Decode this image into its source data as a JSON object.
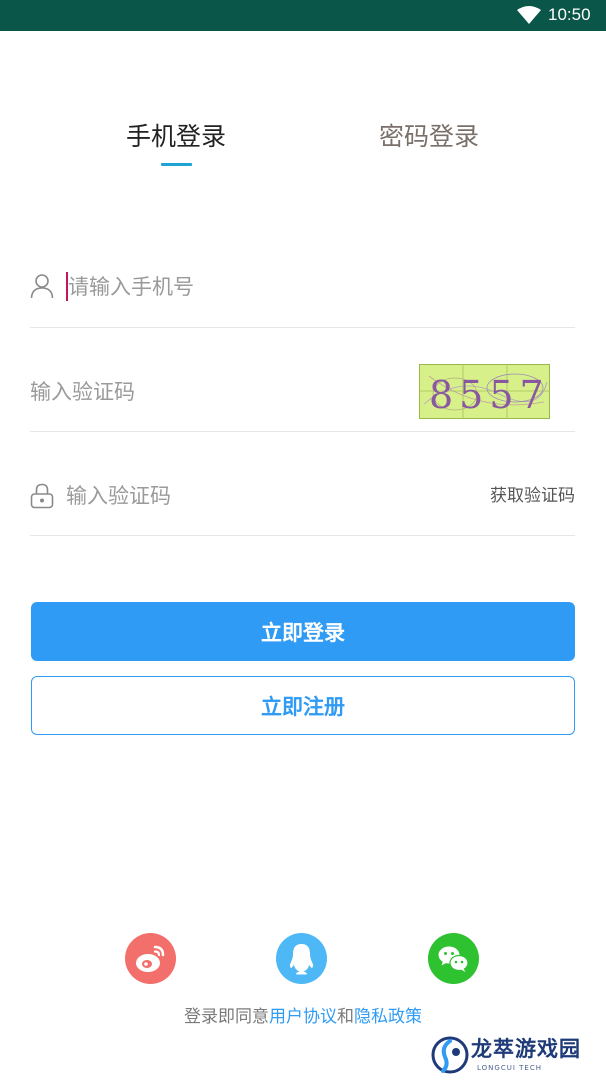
{
  "status_bar": {
    "time": "10:50"
  },
  "tabs": [
    {
      "label": "手机登录",
      "active": true
    },
    {
      "label": "密码登录",
      "active": false
    }
  ],
  "form": {
    "phone_placeholder": "请输入手机号",
    "captcha_placeholder": "输入验证码",
    "captcha_code": "8557",
    "sms_placeholder": "输入验证码",
    "get_code_label": "获取验证码"
  },
  "buttons": {
    "login_label": "立即登录",
    "register_label": "立即注册"
  },
  "social": {
    "weibo_icon": "weibo-icon",
    "qq_icon": "qq-icon",
    "wechat_icon": "wechat-icon"
  },
  "agreement": {
    "prefix": "登录即同意",
    "user_agreement": "用户协议",
    "and": "和",
    "privacy_policy": "隐私政策"
  },
  "watermark": {
    "name": "龙萃游戏园",
    "subtitle": "LONGCUI TECH"
  },
  "colors": {
    "status_bar": "#0a5648",
    "primary": "#2f9bf5",
    "tab_underline": "#1fa2d4",
    "weibo": "#f26f6c",
    "qq": "#4db8f5",
    "wechat": "#2ec130"
  }
}
